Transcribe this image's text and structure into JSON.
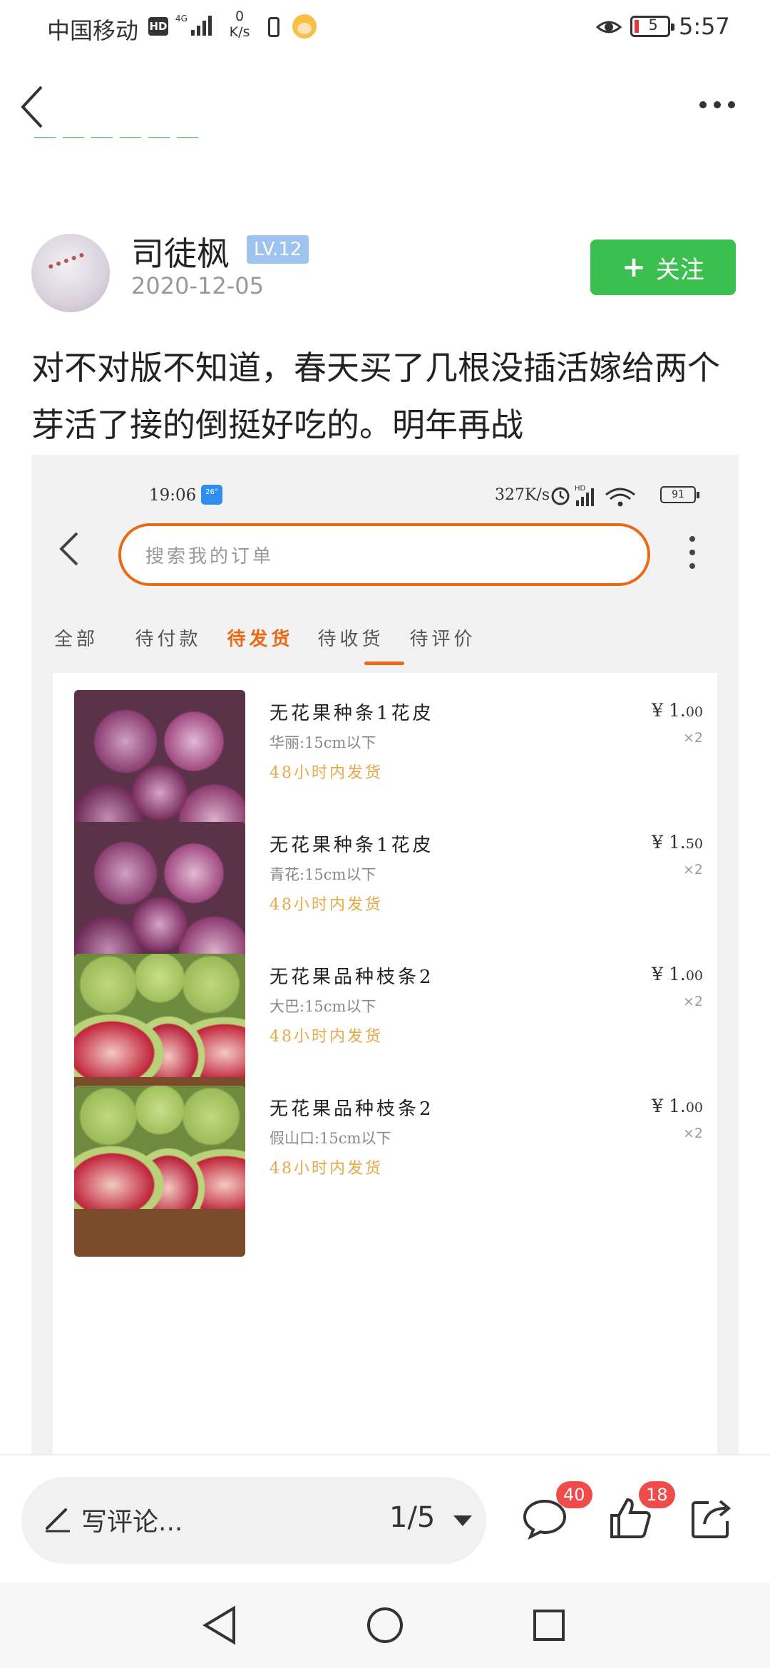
{
  "status_bar": {
    "carrier": "中国移动",
    "hd": "HD",
    "net_type": "4G",
    "speed_value": "0",
    "speed_unit": "K/s",
    "battery": "5",
    "time": "5:57"
  },
  "author": {
    "name": "司徒枫",
    "level": "LV.12",
    "date": "2020-12-05",
    "follow_label": "关注"
  },
  "post": {
    "text": "对不对版不知道，春天买了几根没插活嫁给两个芽活了接的倒挺好吃的。明年再战"
  },
  "screenshot": {
    "time": "19:06",
    "weather": "26°",
    "speed": "327K/s",
    "battery": "91",
    "search_placeholder": "搜索我的订单",
    "tabs": [
      {
        "label": "全部"
      },
      {
        "label": "待付款"
      },
      {
        "label": "待发货"
      },
      {
        "label": "待收货"
      },
      {
        "label": "待评价"
      }
    ],
    "active_tab": "待发货",
    "orders": [
      {
        "name": "无花果种条1花皮",
        "spec": "华丽:15cm以下",
        "ship": "48小时内发货",
        "price_main": "¥ 1.",
        "price_cents": "00",
        "qty": "×2",
        "image": "purple-figs"
      },
      {
        "name": "无花果种条1花皮",
        "spec": "青花:15cm以下",
        "ship": "48小时内发货",
        "price_main": "¥ 1.",
        "price_cents": "50",
        "qty": "×2",
        "image": "purple-figs"
      },
      {
        "name": "无花果品种枝条2",
        "spec": "大巴:15cm以下",
        "ship": "48小时内发货",
        "price_main": "¥ 1.",
        "price_cents": "00",
        "qty": "×2",
        "image": "green-figs"
      },
      {
        "name": "无花果品种枝条2",
        "spec": "假山口:15cm以下",
        "ship": "48小时内发货",
        "price_main": "¥ 1.",
        "price_cents": "00",
        "qty": "×2",
        "image": "green-figs"
      }
    ]
  },
  "bottom_bar": {
    "comment_placeholder": "写评论...",
    "page_indicator": "1/5",
    "comment_count": "40",
    "like_count": "18"
  },
  "icons": {
    "back": "chevron-left-icon",
    "more": "more-dots-icon",
    "edit": "pencil-icon",
    "comment": "comment-bubble-icon",
    "like": "thumbs-up-icon",
    "share": "share-icon"
  },
  "colors": {
    "accent_green": "#3bbf4f",
    "level_blue": "#9ec3ee",
    "order_orange": "#e96a17",
    "ship_gold": "#e4a94a",
    "badge_red": "#f04b4b"
  }
}
